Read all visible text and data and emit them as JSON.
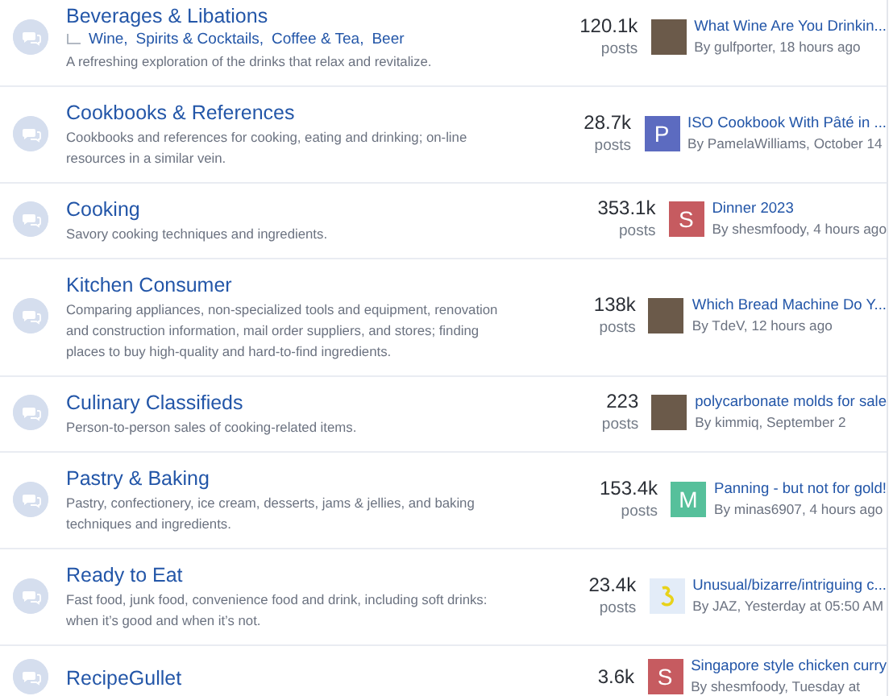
{
  "forums": [
    {
      "title": "Beverages & Libations",
      "subforums": [
        "Wine,",
        "Spirits & Cocktails,",
        "Coffee & Tea,",
        "Beer"
      ],
      "description": "A refreshing exploration of the drinks that relax and revitalize.",
      "count": "120.1k",
      "unit": "posts",
      "latest": {
        "title": "What Wine Are You Drinkin...",
        "byline": "By gulfporter, 18 hours ago",
        "avatar": {
          "kind": "photo"
        }
      }
    },
    {
      "title": "Cookbooks & References",
      "description": "Cookbooks and references for cooking, eating and drinking; on-line resources in a similar vein.",
      "count": "28.7k",
      "unit": "posts",
      "latest": {
        "title": "ISO Cookbook With Pâté in ...",
        "byline": "By PamelaWilliams, October 14",
        "avatar": {
          "kind": "letter",
          "letter": "P",
          "color": "#5c6bc0"
        }
      }
    },
    {
      "title": "Cooking",
      "description": "Savory cooking techniques and ingredients.",
      "count": "353.1k",
      "unit": "posts",
      "latest": {
        "title": "Dinner 2023",
        "byline": "By shesmfoody, 4 hours ago",
        "avatar": {
          "kind": "letter",
          "letter": "S",
          "color": "#c65b60"
        }
      }
    },
    {
      "title": "Kitchen Consumer",
      "description": "Comparing appliances, non-specialized tools and equipment, renovation and construction information, mail order suppliers, and stores; finding places to buy high-quality and hard-to-find ingredients.",
      "count": "138k",
      "unit": "posts",
      "latest": {
        "title": "Which Bread Machine Do Y...",
        "byline": "By TdeV, 12 hours ago",
        "avatar": {
          "kind": "photo"
        }
      }
    },
    {
      "title": "Culinary Classifieds",
      "description": "Person-to-person sales of cooking-related items.",
      "count": "223",
      "unit": "posts",
      "latest": {
        "title": "polycarbonate molds for sale",
        "byline": "By kimmiq, September 2",
        "avatar": {
          "kind": "photo"
        }
      }
    },
    {
      "title": "Pastry & Baking",
      "description": "Pastry, confectionery, ice cream, desserts, jams & jellies, and baking techniques and ingredients.",
      "count": "153.4k",
      "unit": "posts",
      "latest": {
        "title": "Panning - but not for gold!",
        "byline": "By minas6907, 4 hours ago",
        "avatar": {
          "kind": "letter",
          "letter": "M",
          "color": "#56c09b"
        }
      }
    },
    {
      "title": "Ready to Eat",
      "description": "Fast food, junk food, convenience food and drink, including soft drinks: when it’s good and when it’s not.",
      "count": "23.4k",
      "unit": "posts",
      "latest": {
        "title": "Unusual/bizarre/intriguing c...",
        "byline": "By JAZ, Yesterday at 05:50 AM",
        "avatar": {
          "kind": "drawing"
        }
      }
    },
    {
      "title": "RecipeGullet",
      "count": "3.6k",
      "latest": {
        "title": "Singapore style chicken curry",
        "byline": "By shesmfoody, Tuesday at",
        "avatar": {
          "kind": "letter",
          "letter": "S",
          "color": "#c65b60"
        }
      }
    }
  ]
}
